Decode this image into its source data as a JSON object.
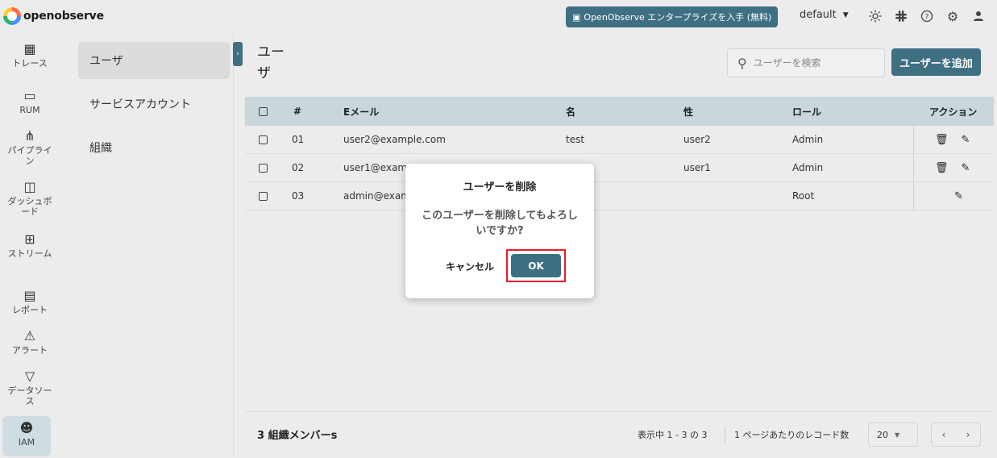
{
  "header": {
    "logo_text": "openobserve",
    "enterprise_label": "OpenObserve エンタープライズを入手 (無料)",
    "org": "default",
    "icons": [
      "sun-icon",
      "slack-icon",
      "help-icon",
      "gear-icon",
      "user-icon"
    ]
  },
  "rail": {
    "items": [
      {
        "label": "トレース",
        "icon": "traces-icon"
      },
      {
        "label": "RUM",
        "icon": "rum-icon"
      },
      {
        "label": "パイプライン",
        "icon": "pipeline-icon"
      },
      {
        "label": "ダッシュボード",
        "icon": "dashboard-icon"
      },
      {
        "label": "ストリーム",
        "icon": "streams-icon"
      },
      {
        "label": "レポート",
        "icon": "reports-icon"
      },
      {
        "label": "アラート",
        "icon": "alert-icon"
      },
      {
        "label": "データソース",
        "icon": "datasource-icon"
      },
      {
        "label": "IAM",
        "icon": "iam-icon"
      }
    ]
  },
  "subnav": {
    "items": [
      "ユーザ",
      "サービスアカウント",
      "組織"
    ]
  },
  "main": {
    "title": "ユーザ",
    "search_placeholder": "ユーザーを検索",
    "add_label": "ユーザーを追加"
  },
  "table": {
    "headers": {
      "num": "#",
      "email": "Eメール",
      "first": "名",
      "last": "性",
      "role": "ロール",
      "actions": "アクション"
    },
    "rows": [
      {
        "num": "01",
        "email": "user2@example.com",
        "first": "test",
        "last": "user2",
        "role": "Admin"
      },
      {
        "num": "02",
        "email": "user1@examp",
        "first": "",
        "last": "user1",
        "role": "Admin"
      },
      {
        "num": "03",
        "email": "admin@exam",
        "first": "",
        "last": "",
        "role": "Root"
      }
    ]
  },
  "footer": {
    "members": "3 組織メンバーs",
    "range": "表示中 1 - 3 の 3",
    "per_page_label": "1 ページあたりのレコード数",
    "per_page_value": "20"
  },
  "dialog": {
    "title": "ユーザーを削除",
    "message": "このユーザーを削除してもよろしいですか?",
    "cancel": "キャンセル",
    "ok": "OK"
  }
}
